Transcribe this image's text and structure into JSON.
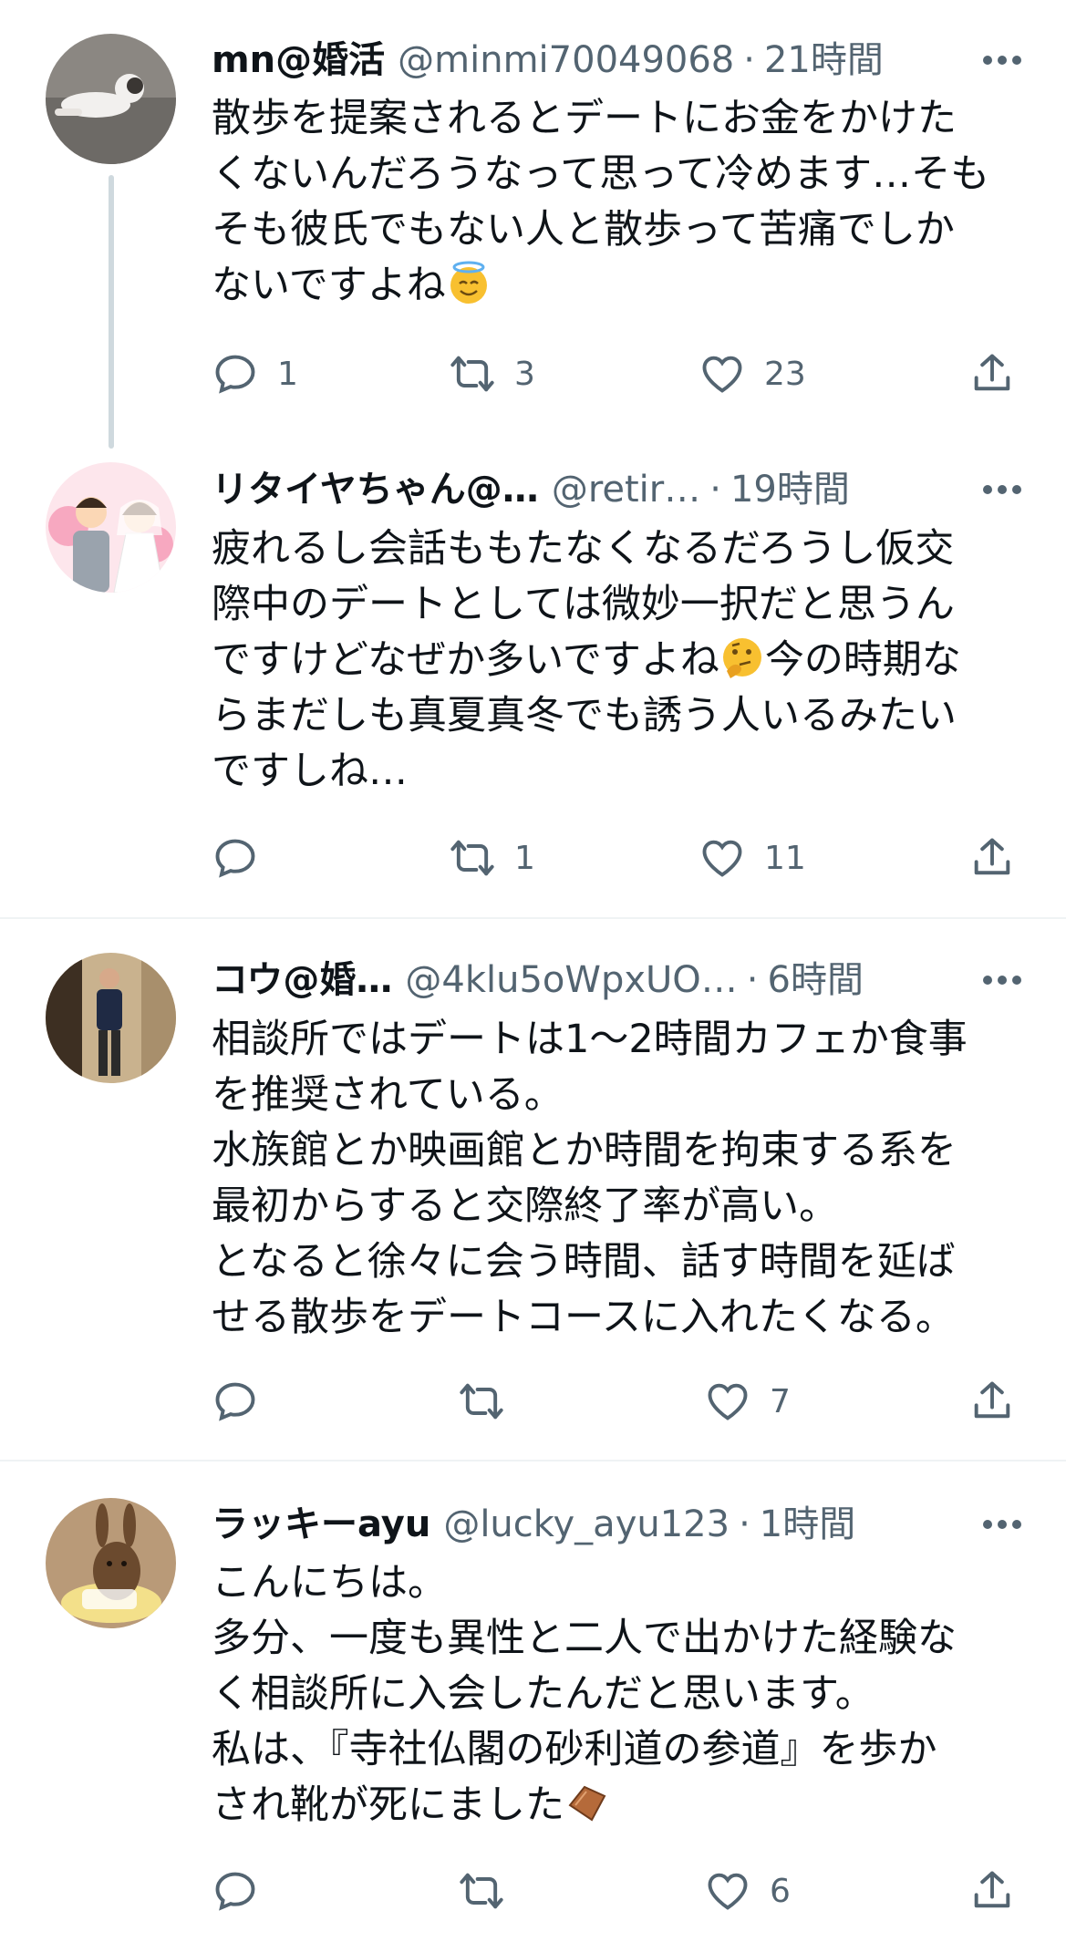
{
  "tweets": [
    {
      "display_name": "mn@婚活",
      "handle": "@minmi70049068",
      "dot": "·",
      "time": "21時間",
      "text_before": "散歩を提案されるとデートにお金をかけた\nくないんだろうなって思って冷めます…そも\nそも彼氏でもない人と散歩って苦痛でしか\nないですよね",
      "emoji": "smiling-face-with-halo",
      "text_after": "",
      "avatar": "cat-photo",
      "counts": {
        "reply": "1",
        "retweet": "3",
        "like": "23"
      }
    },
    {
      "display_name": "リタイヤちゃん@…",
      "handle": "@retir…",
      "dot": "·",
      "time": "19時間",
      "text_before": "疲れるし会話ももたなくなるだろうし仮交\n際中のデートとしては微妙一択だと思うん\nですけどなぜか多いですよね",
      "emoji": "thinking-face",
      "text_after": "今の時期な\nらまだしも真夏真冬でも誘う人いるみたい\nですしね…",
      "avatar": "wedding-couple-illustration",
      "counts": {
        "reply": "",
        "retweet": "1",
        "like": "11"
      }
    },
    {
      "display_name": "コウ@婚…",
      "handle": "@4klu5oWpxUO…",
      "dot": "·",
      "time": "6時間",
      "text_before": "相談所ではデートは1〜2時間カフェか食事\nを推奨されている。\n水族館とか映画館とか時間を拘束する系を\n最初からすると交際終了率が高い。\nとなると徐々に会う時間、話す時間を延ば\nせる散歩をデートコースに入れたくなる。",
      "emoji": "",
      "text_after": "",
      "avatar": "man-standing-photo",
      "counts": {
        "reply": "",
        "retweet": "",
        "like": "7"
      }
    },
    {
      "display_name": "ラッキーayu",
      "handle": "@lucky_ayu123",
      "dot": "·",
      "time": "1時間",
      "text_before": "こんにちは。\n多分、一度も異性と二人で出かけた経験な\nく相談所に入会したんだと思います。\n私は、『寺社仏閣の砂利道の参道』を歩か\nされ靴が死にました",
      "emoji": "coffin",
      "text_after": "",
      "avatar": "rabbit-figure-photo",
      "counts": {
        "reply": "",
        "retweet": "",
        "like": "6"
      }
    }
  ],
  "colors": {
    "text": "#0f1419",
    "secondary": "#536471",
    "separator": "#eff3f4",
    "thread_line": "#cfd9de"
  }
}
